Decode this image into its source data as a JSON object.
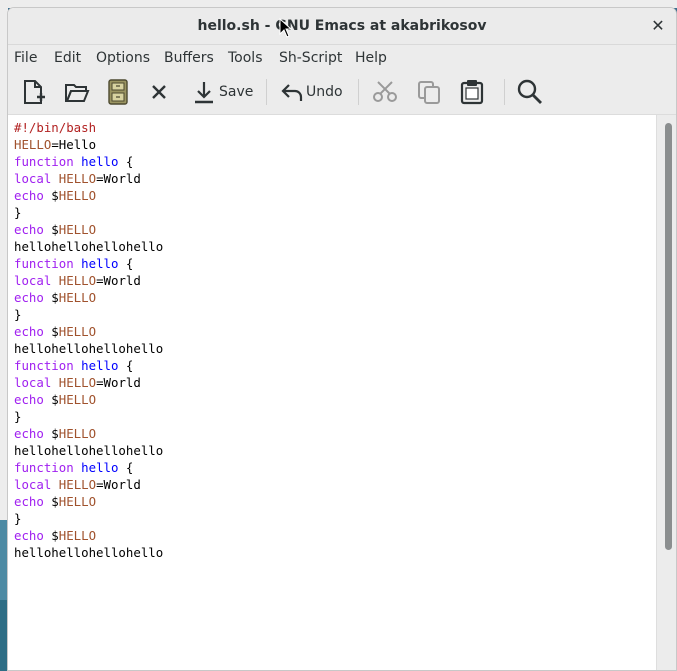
{
  "window": {
    "title": "hello.sh - GNU Emacs at akabrikosov",
    "close_glyph": "✕"
  },
  "menu": {
    "items": [
      {
        "label": "File"
      },
      {
        "label": "Edit"
      },
      {
        "label": "Options"
      },
      {
        "label": "Buffers"
      },
      {
        "label": "Tools"
      },
      {
        "label": "Sh-Script"
      },
      {
        "label": "Help"
      }
    ]
  },
  "toolbar": {
    "save_label": "Save",
    "undo_label": "Undo",
    "icons": [
      "new-file-icon",
      "open-folder-icon",
      "save-buffer-icon",
      "close-icon",
      "save-icon",
      "undo-icon",
      "cut-icon",
      "copy-icon",
      "paste-icon",
      "search-icon"
    ]
  },
  "editor": {
    "lines": [
      "#!/bin/bash",
      "HELLO=Hello",
      "function hello {",
      "local HELLO=World",
      "echo $HELLO",
      "}",
      "echo $HELLO",
      "hellohellohellohello",
      "function hello {",
      "local HELLO=World",
      "echo $HELLO",
      "}",
      "echo $HELLO",
      "hellohellohellohello",
      "function hello {",
      "local HELLO=World",
      "echo $HELLO",
      "}",
      "echo $HELLO",
      "hellohellohellohello",
      "function hello {",
      "local HELLO=World",
      "echo $HELLO",
      "}",
      "echo $HELLO",
      "hellohellohellohello"
    ]
  },
  "colors": {
    "keyword": "#a020f0",
    "function_name": "#0000ff",
    "variable": "#a0522d",
    "comment": "#b22222"
  }
}
